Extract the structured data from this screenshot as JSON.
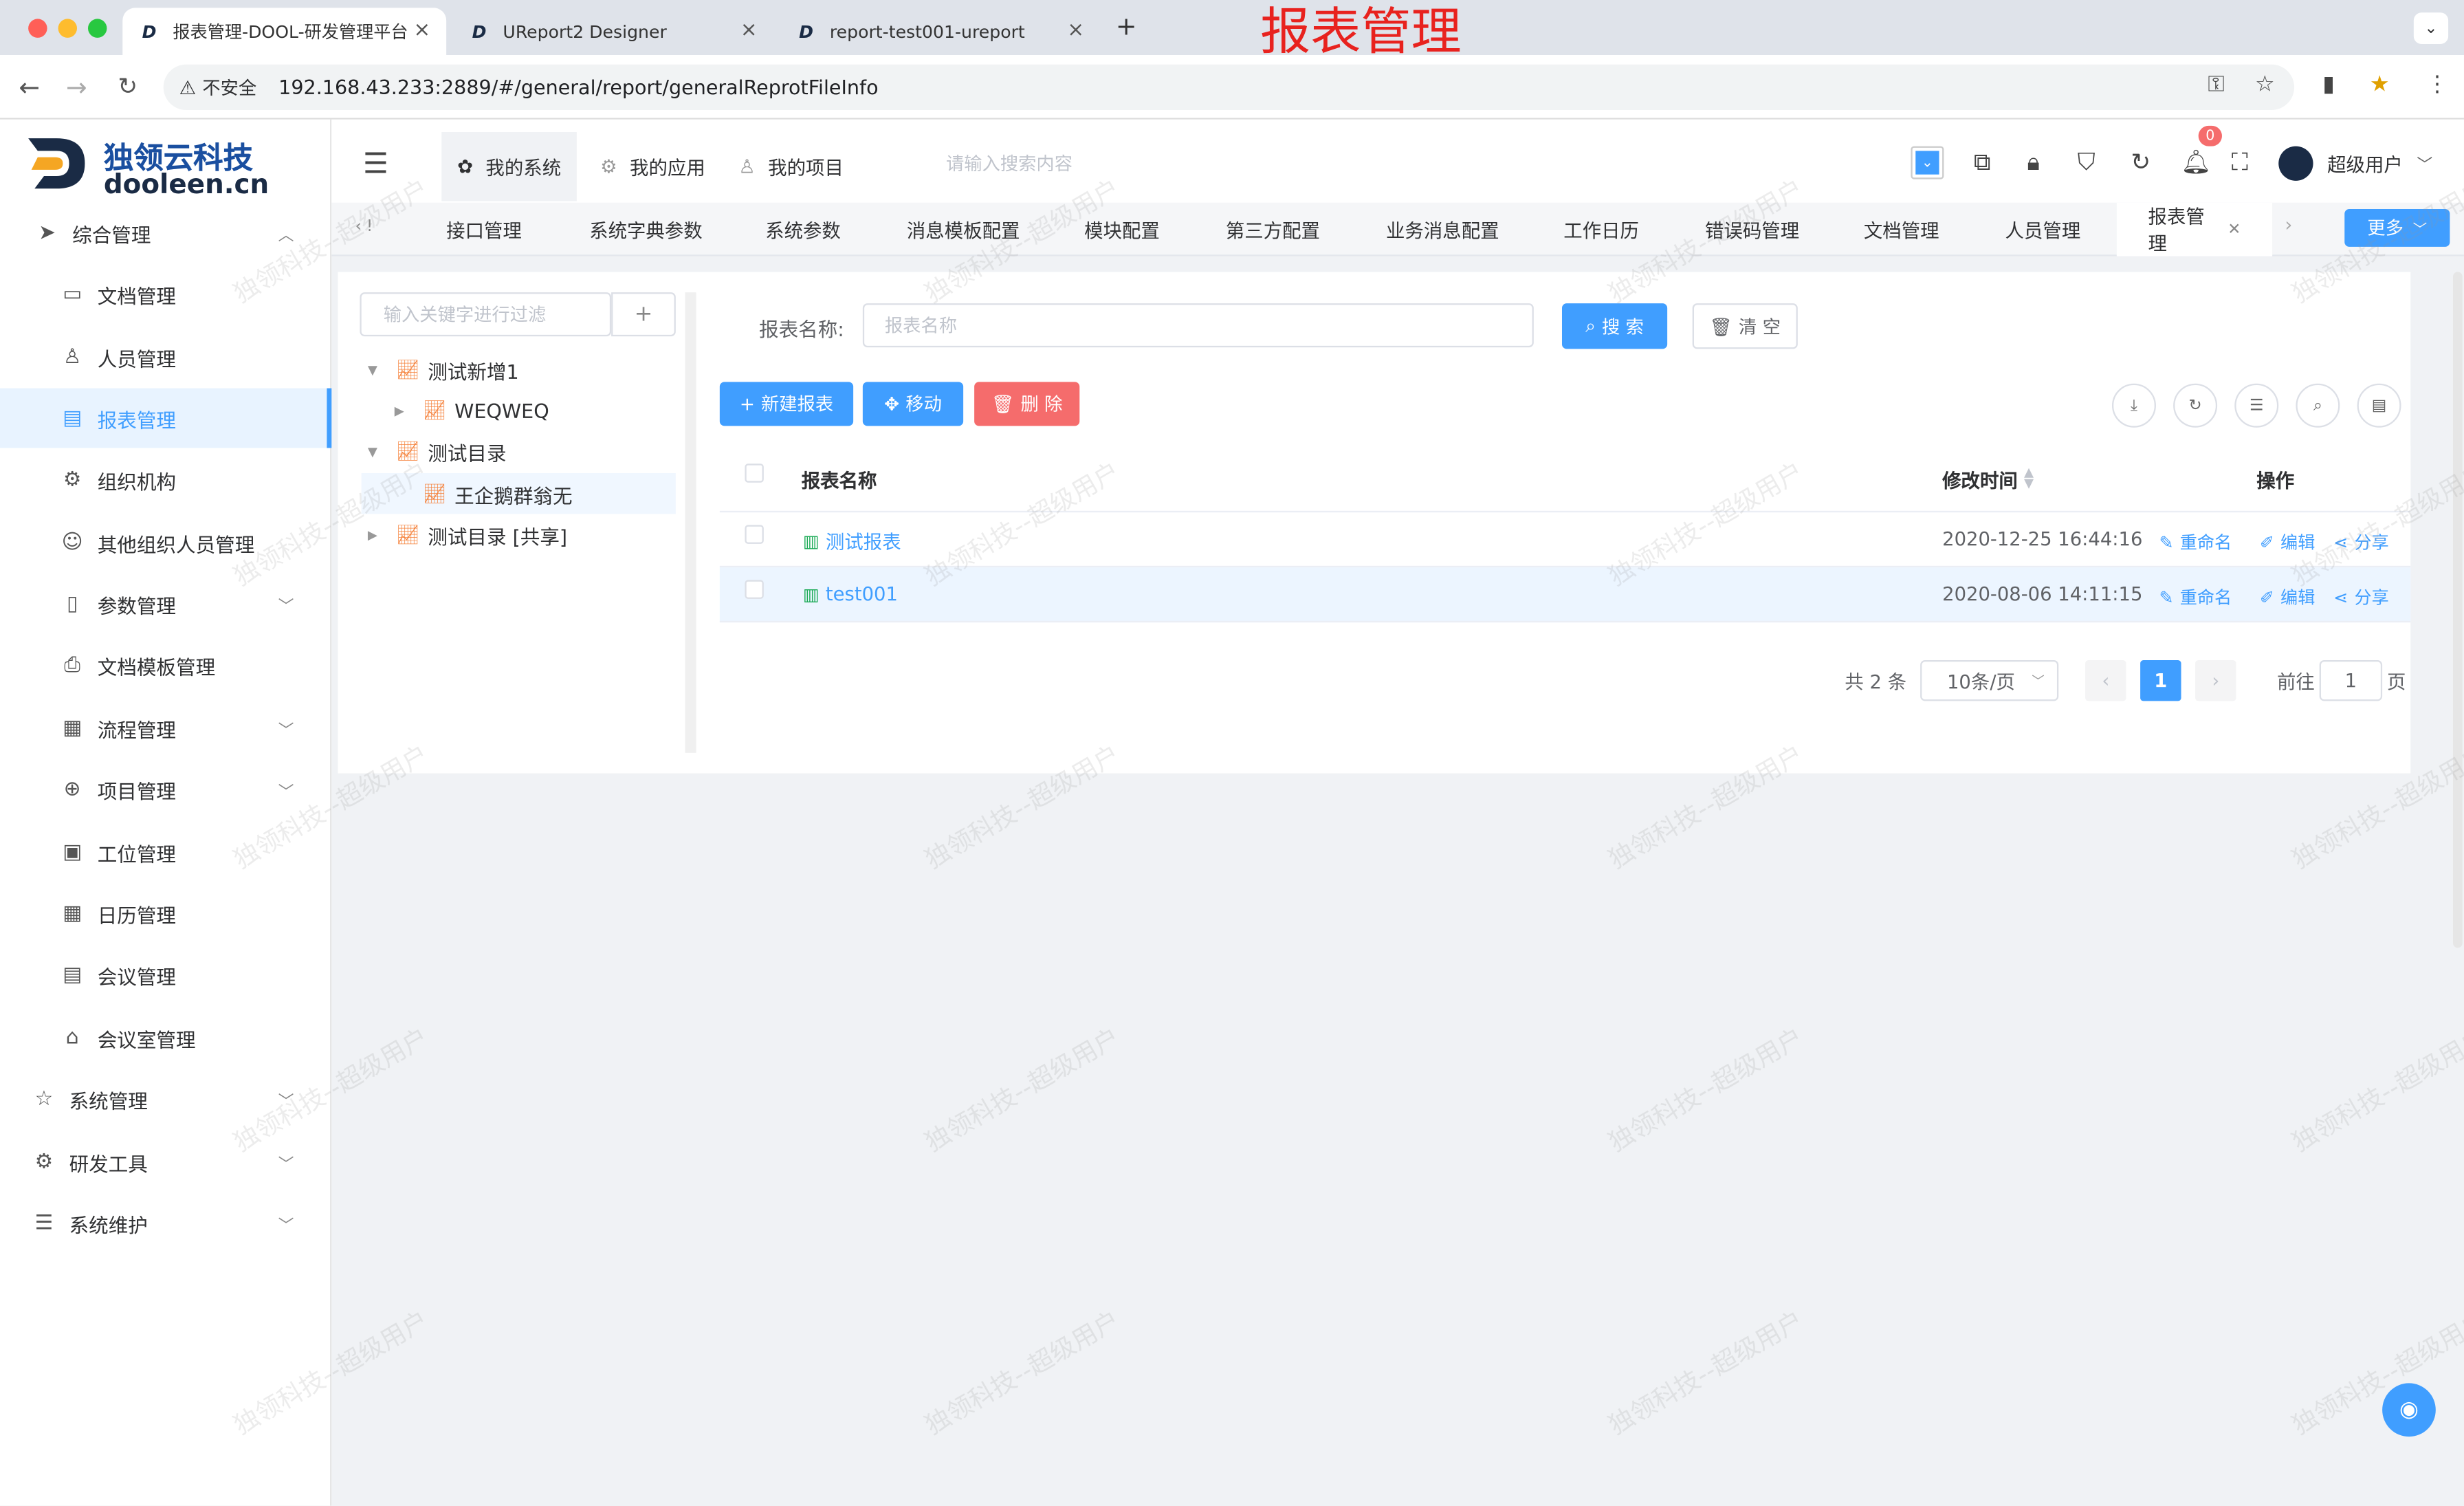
{
  "browser": {
    "tabs": [
      {
        "title": "报表管理-DOOL-研发管理平台"
      },
      {
        "title": "UReport2 Designer"
      },
      {
        "title": "report-test001-ureport"
      }
    ],
    "url": "192.168.43.233:2889/#/general/report/generalReprotFileInfo",
    "security_label": "不安全",
    "overlay_title": "报表管理"
  },
  "logo": {
    "title": "独领云科技",
    "subtitle": "dooleen.cn"
  },
  "sidebar": {
    "items": [
      {
        "label": "综合管理",
        "icon": "send-icon"
      },
      {
        "label": "文档管理",
        "icon": "folder-icon"
      },
      {
        "label": "人员管理",
        "icon": "user-icon"
      },
      {
        "label": "报表管理",
        "icon": "report-icon"
      },
      {
        "label": "组织机构",
        "icon": "gear-icon"
      },
      {
        "label": "其他组织人员管理",
        "icon": "smile-icon"
      },
      {
        "label": "参数管理",
        "icon": "book-icon"
      },
      {
        "label": "文档模板管理",
        "icon": "printer-icon"
      },
      {
        "label": "流程管理",
        "icon": "calendar-icon"
      },
      {
        "label": "项目管理",
        "icon": "plus-circle-icon"
      },
      {
        "label": "工位管理",
        "icon": "clipboard-icon"
      },
      {
        "label": "日历管理",
        "icon": "calendar-icon"
      },
      {
        "label": "会议管理",
        "icon": "doc-icon"
      },
      {
        "label": "会议室管理",
        "icon": "home-icon"
      },
      {
        "label": "系统管理",
        "icon": "star-icon"
      },
      {
        "label": "研发工具",
        "icon": "settings-icon"
      },
      {
        "label": "系统维护",
        "icon": "sliders-icon"
      }
    ]
  },
  "header": {
    "tabs": [
      {
        "label": "我的系统"
      },
      {
        "label": "我的应用"
      },
      {
        "label": "我的项目"
      }
    ],
    "search_placeholder": "请输入搜索内容",
    "notification_count": "0",
    "username": "超级用户"
  },
  "tagsbar": {
    "tags": [
      "接口管理",
      "系统字典参数",
      "系统参数",
      "消息模板配置",
      "模块配置",
      "第三方配置",
      "业务消息配置",
      "工作日历",
      "错误码管理",
      "文档管理",
      "人员管理",
      "报表管理"
    ],
    "more_label": "更多"
  },
  "tree": {
    "filter_placeholder": "输入关键字进行过滤",
    "nodes": [
      {
        "label": "测试新增1"
      },
      {
        "label": "WEQWEQ"
      },
      {
        "label": "测试目录"
      },
      {
        "label": "王企鹅群翁无"
      },
      {
        "label": "测试目录 [共享]"
      }
    ]
  },
  "search": {
    "label": "报表名称:",
    "placeholder": "报表名称",
    "search_btn": "搜 索",
    "clear_btn": "清 空"
  },
  "actions": {
    "new_btn": "新建报表",
    "move_btn": "移动",
    "delete_btn": "删 除"
  },
  "table": {
    "headers": {
      "name": "报表名称",
      "time": "修改时间",
      "ops": "操作"
    },
    "rows": [
      {
        "name": "测试报表",
        "time": "2020-12-25 16:44:16",
        "rename": "重命名",
        "edit": "编辑",
        "share": "分享"
      },
      {
        "name": "test001",
        "time": "2020-08-06 14:11:15",
        "rename": "重命名",
        "edit": "编辑",
        "share": "分享"
      }
    ]
  },
  "pagination": {
    "total": "共 2 条",
    "page_size": "10条/页",
    "current": "1",
    "goto_label": "前往",
    "goto_value": "1",
    "page_suffix": "页"
  },
  "watermark": "独领科技--超级用户",
  "colors": {
    "primary": "#409eff",
    "danger": "#f56c6c",
    "brand": "#1a4fa0"
  }
}
